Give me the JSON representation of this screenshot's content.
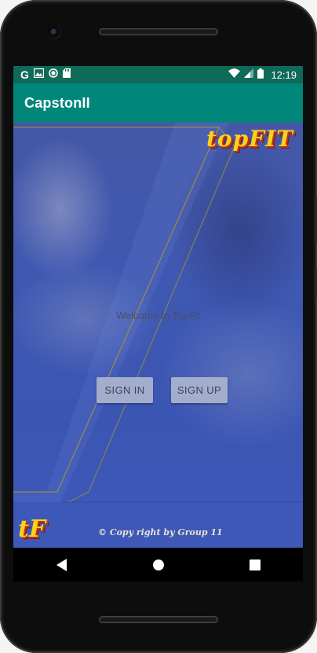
{
  "status_bar": {
    "left_icons": [
      "google-g-icon",
      "photo-icon",
      "circle-notification-icon",
      "sd-card-icon"
    ],
    "google_letter": "G",
    "right_icons": [
      "wifi-icon",
      "cell-signal-icon",
      "battery-icon"
    ],
    "time": "12:19",
    "background": "#0e6a59"
  },
  "app_bar": {
    "title": "CapstonII",
    "background": "#00877a"
  },
  "main": {
    "logo_top": "topFIT",
    "logo_corner": "tF",
    "welcome_text": "Welcome to TopFit",
    "sign_in_label": "SIGN IN",
    "sign_up_label": "SIGN UP",
    "copyright": "© Copy right by Group 11",
    "background": "#3f58b2"
  },
  "nav_bar": {
    "items": [
      "back-icon",
      "home-icon",
      "recents-icon"
    ]
  }
}
